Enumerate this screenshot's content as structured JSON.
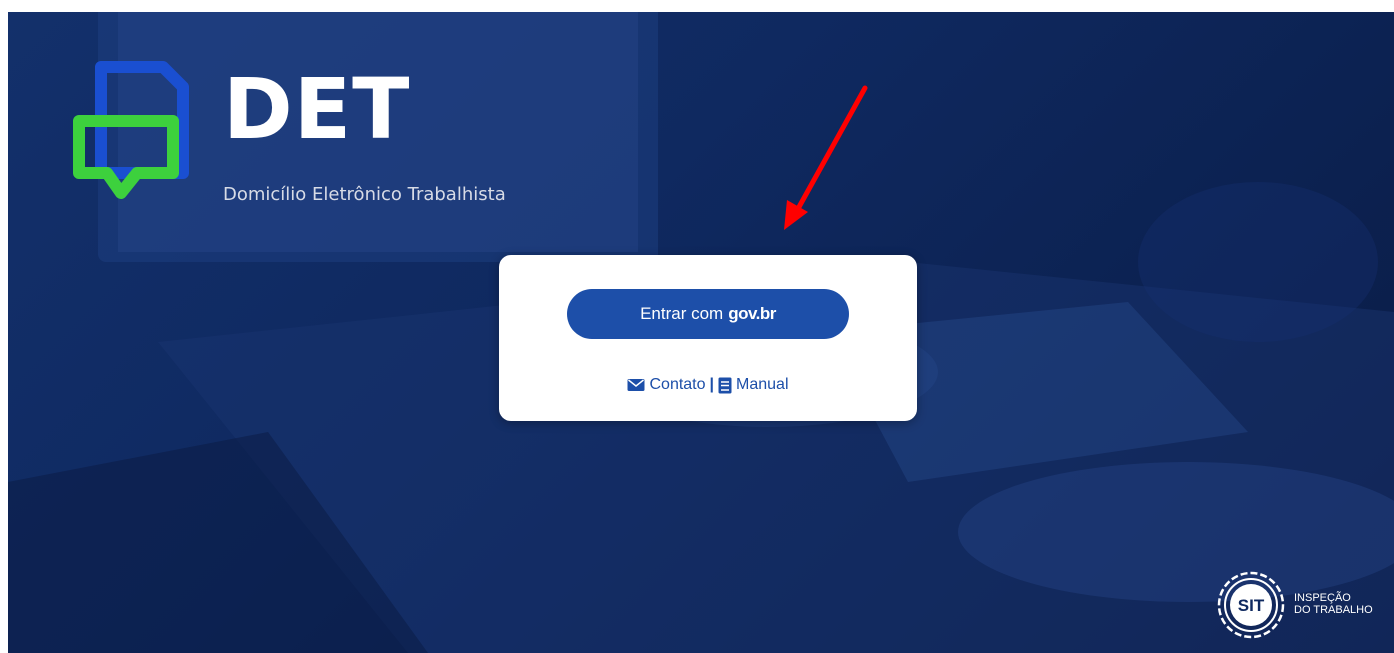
{
  "branding": {
    "title": "DET",
    "subtitle": "Domicílio Eletrônico Trabalhista",
    "logo_colors": {
      "blue": "#1a4fd1",
      "green": "#3dd13d"
    }
  },
  "login": {
    "button_prefix": "Entrar com",
    "button_brand": "gov.br",
    "button_color": "#1d4fa9"
  },
  "links": {
    "contact_label": "Contato",
    "separator": "|",
    "manual_label": "Manual",
    "contact_icon": "envelope-icon",
    "manual_icon": "book-icon"
  },
  "footer": {
    "seal_text": "SIT",
    "org_line1": "INSPEÇÃO",
    "org_line2": "DO TRABALHO"
  },
  "annotation": {
    "arrow_color": "#ff0000"
  }
}
